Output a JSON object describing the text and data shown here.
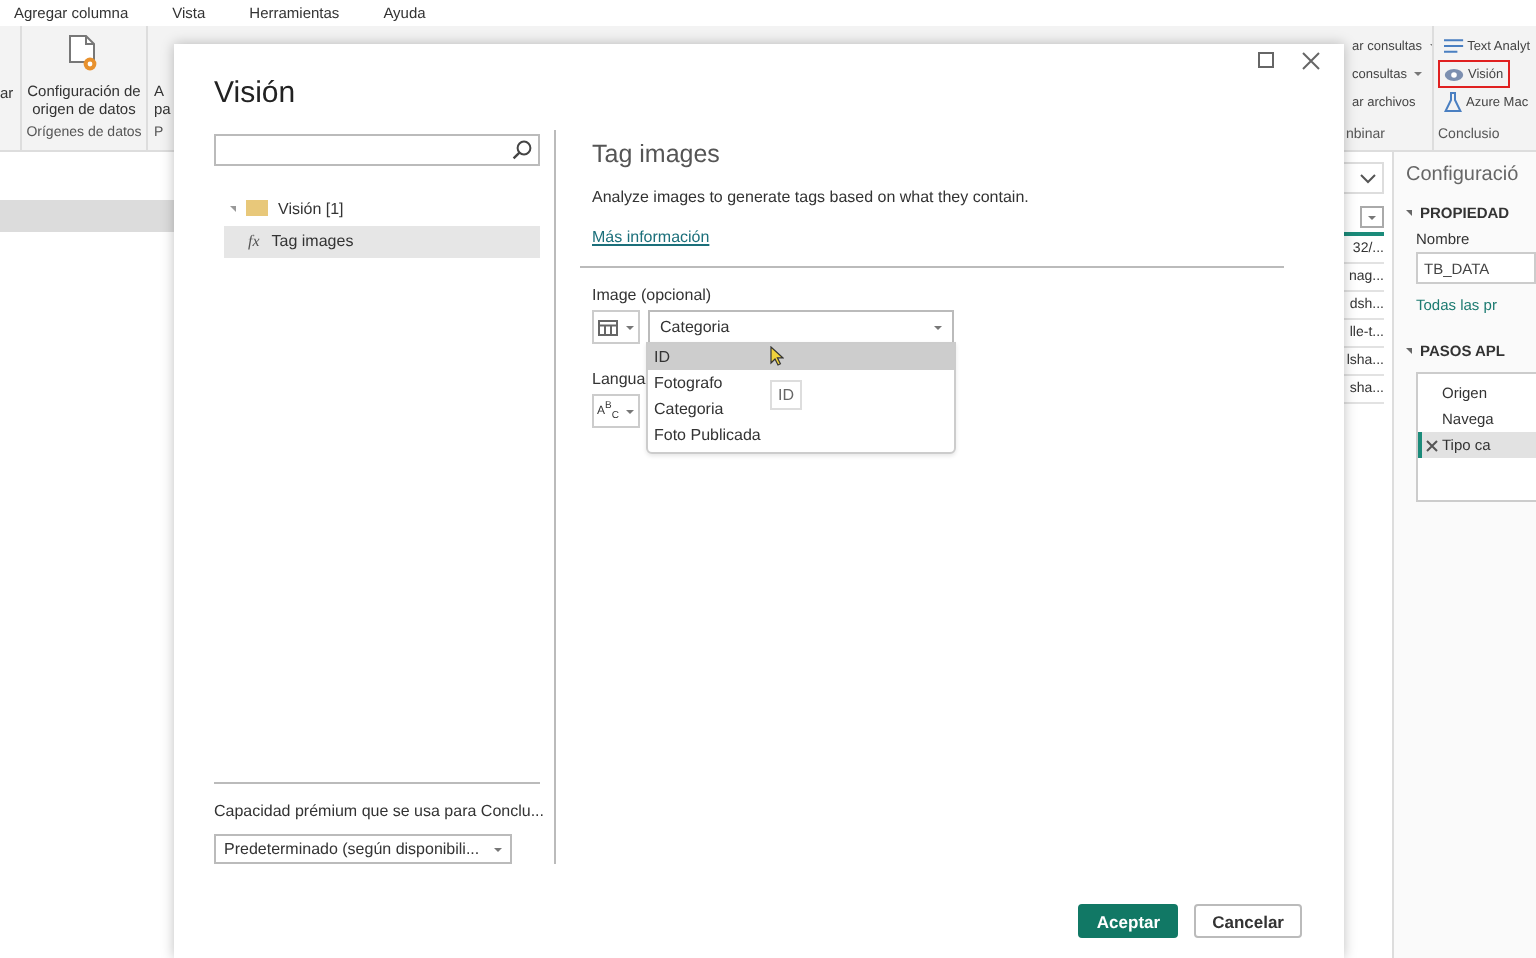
{
  "menu": [
    "Agregar columna",
    "Vista",
    "Herramientas",
    "Ayuda"
  ],
  "ribbon": {
    "partial_left": "ar",
    "config_button": [
      "Configuración de",
      "origen de datos"
    ],
    "partial_button": [
      "A",
      "pa"
    ],
    "groups": [
      "Orígenes de datos",
      "P"
    ],
    "combine": {
      "items": [
        {
          "label": "ar consultas",
          "kind": "dropdown"
        },
        {
          "label": "consultas",
          "kind": "dropdown"
        },
        {
          "label": "ar archivos",
          "kind": "button"
        }
      ],
      "group": "nbinar"
    },
    "insights": {
      "items": [
        {
          "label": "Text Analyt",
          "kind": "text",
          "highlighted": false
        },
        {
          "label": "Visión",
          "kind": "eye",
          "highlighted": true
        },
        {
          "label": "Azure Mac",
          "kind": "flask",
          "highlighted": false
        }
      ],
      "group": "Conclusio"
    }
  },
  "column_cells": [
    "32/...",
    "nag...",
    "dsh...",
    "lle-t...",
    "lsha...",
    "sha..."
  ],
  "settings": {
    "title": "Configuració",
    "properties_heading": "PROPIEDAD",
    "name_label": "Nombre",
    "name_value": "TB_DATA",
    "all_properties_link": "Todas las pr",
    "steps_heading": "PASOS APL",
    "steps": [
      {
        "label": "Origen",
        "selected": false
      },
      {
        "label": "Navega",
        "selected": false
      },
      {
        "label": "Tipo ca",
        "selected": true
      }
    ]
  },
  "dialog": {
    "title": "Visión",
    "tree": [
      {
        "label": "Visión [1]",
        "expanded": true,
        "children": [
          {
            "label": "Tag images",
            "icon_text": "fx",
            "selected": true
          }
        ]
      }
    ],
    "capacity_label": "Capacidad prémium que se usa para Conclu...",
    "capacity_value": "Predeterminado (según disponibili...",
    "function_title": "Tag images",
    "description": "Analyze images to generate tags based on what they contain.",
    "more_info_link": "Más información",
    "image_label": "Image (opcional)",
    "image_value": "Categoria",
    "options": [
      {
        "label": "ID",
        "selected": true
      },
      {
        "label": "Fotografo",
        "selected": false
      },
      {
        "label": "Categoria",
        "selected": false
      },
      {
        "label": "Foto Publicada",
        "selected": false
      }
    ],
    "tooltip": "ID",
    "language_label": "Langua",
    "language_icon": "A$^{B}$$_{C}$",
    "buttons": [
      {
        "label": "Aceptar",
        "kind": "primary"
      },
      {
        "label": "Cancelar",
        "kind": "secondary"
      }
    ]
  }
}
